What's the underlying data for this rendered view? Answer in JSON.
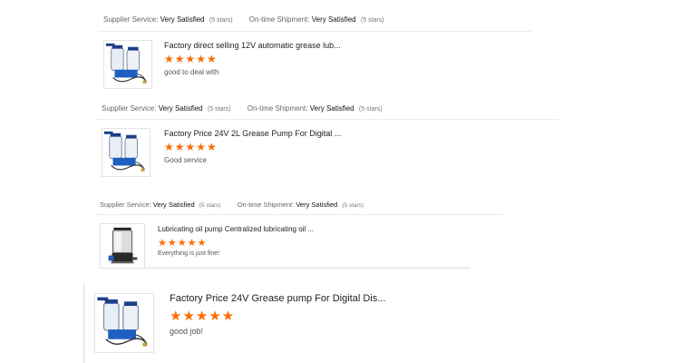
{
  "colors": {
    "star": "#ff6a00",
    "text": "#222222",
    "muted": "#666666"
  },
  "reviews": [
    {
      "ratings": {
        "supplier_label": "Supplier Service:",
        "supplier_value": "Very Satisfied",
        "supplier_stars": "(5 stars)",
        "shipment_label": "On-time Shipment:",
        "shipment_value": "Very Satisfied",
        "shipment_stars": "(5 stars)"
      },
      "product_title": "Factory direct selling 12V automatic grease lub...",
      "stars": "★★★★★",
      "rating": 5,
      "comment": "good to deal with",
      "thumb_icon": "grease-pump-image"
    },
    {
      "ratings": {
        "supplier_label": "Supplier Service:",
        "supplier_value": "Very Satisfied",
        "supplier_stars": "(5 stars)",
        "shipment_label": "On-time Shipment:",
        "shipment_value": "Very Satisfied",
        "shipment_stars": "(5 stars)"
      },
      "product_title": "Factory Price 24V 2L Grease Pump For Digital ...",
      "stars": "★★★★★",
      "rating": 5,
      "comment": "Good service",
      "thumb_icon": "grease-pump-image"
    },
    {
      "ratings": {
        "supplier_label": "Supplier Service:",
        "supplier_value": "Very Satisfied",
        "supplier_stars": "(5 stars)",
        "shipment_label": "On-time Shipment:",
        "shipment_value": "Very Satisfied",
        "shipment_stars": "(5 stars)"
      },
      "product_title": "Lubricating oil pump Centralized lubricating oil ...",
      "stars": "★★★★★",
      "rating": 5,
      "comment": "Everything is just fine!",
      "thumb_icon": "lubricating-pump-image"
    },
    {
      "product_title": "Factory Price 24V Grease pump For Digital Dis...",
      "stars": "★★★★★",
      "rating": 5,
      "comment": "good job!",
      "thumb_icon": "grease-pump-image"
    }
  ]
}
